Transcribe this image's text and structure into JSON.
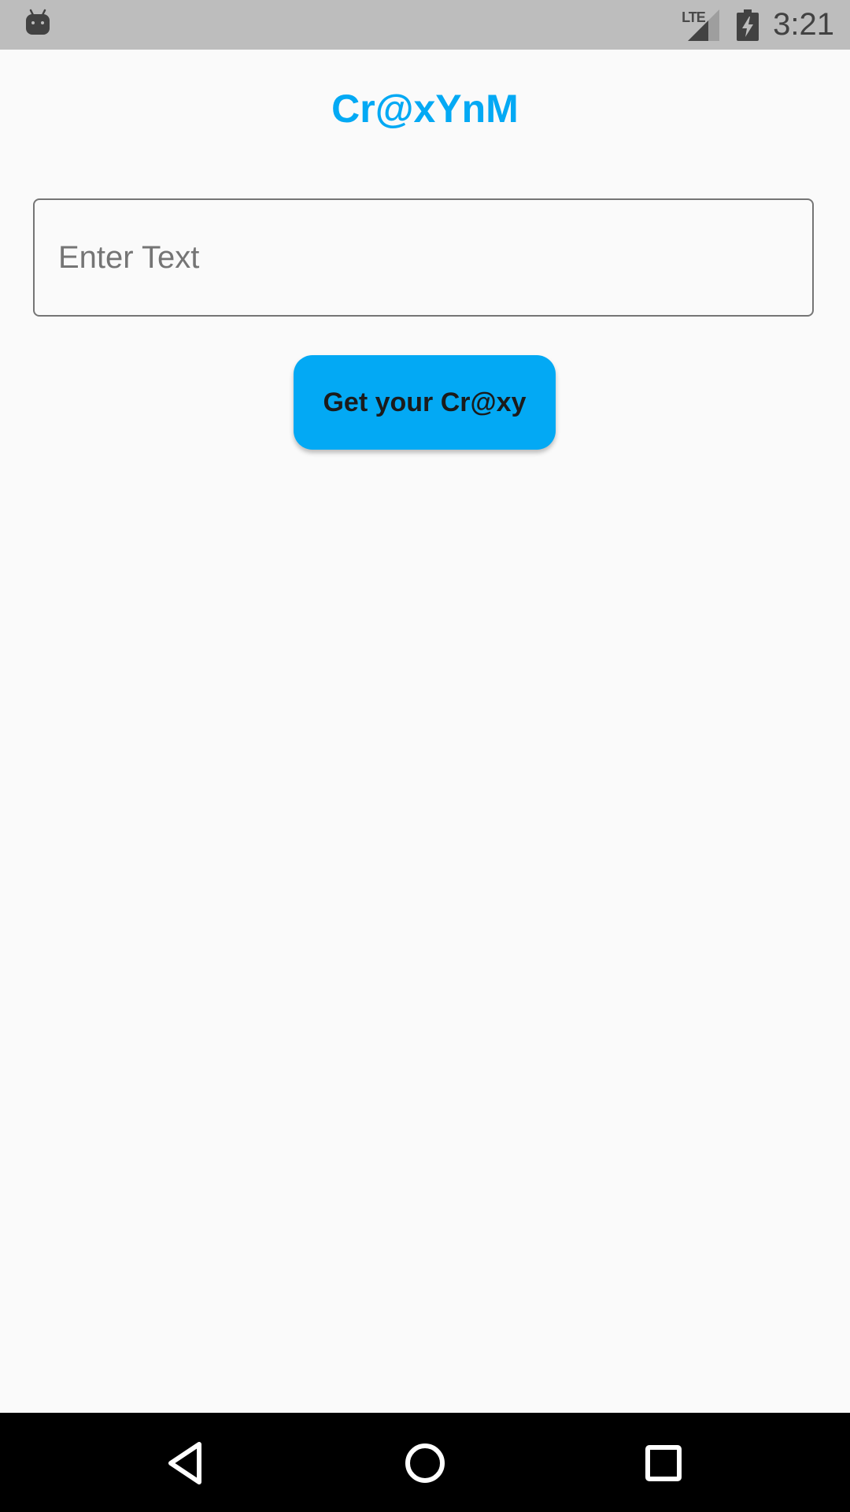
{
  "status_bar": {
    "network_label": "LTE",
    "time": "3:21",
    "icons": [
      "android-icon",
      "signal-icon",
      "battery-charging-icon"
    ]
  },
  "app": {
    "title": "Cr@xYnM"
  },
  "input": {
    "placeholder": "Enter Text",
    "value": ""
  },
  "button": {
    "label": "Get your Cr@xy"
  },
  "nav_bar": {
    "icons": [
      "back-icon",
      "home-icon",
      "recents-icon"
    ]
  },
  "colors": {
    "accent": "#03a9f4",
    "background": "#fafafa",
    "status_bar": "#bdbdbd",
    "nav_bar": "#000000"
  }
}
